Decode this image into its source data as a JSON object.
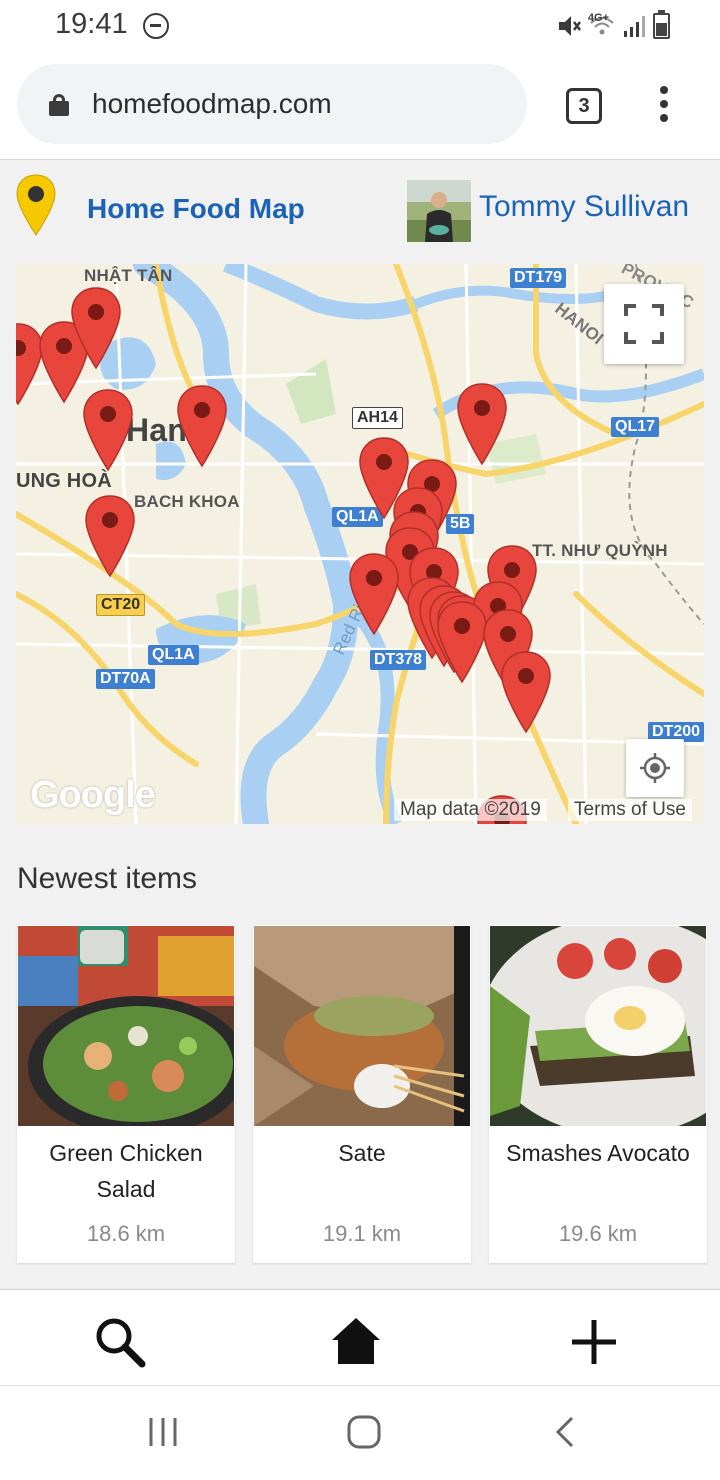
{
  "status_bar": {
    "time": "19:41",
    "network": "4G+",
    "icons": [
      "do-not-disturb-icon",
      "mute-icon",
      "wifi-icon",
      "signal-icon",
      "battery-icon"
    ]
  },
  "browser": {
    "url": "homefoodmap.com",
    "tab_count": "3",
    "icons": [
      "lock-icon",
      "more-vert-icon"
    ]
  },
  "header": {
    "brand": "Home Food Map",
    "user_name": "Tommy Sullivan",
    "brand_color": "#1a63b8",
    "logo_color": "#f6c800"
  },
  "map": {
    "labels": {
      "nhat_tan": "NHẬT TÂN",
      "hanoi": "Hanoi",
      "trung_hoa": "UNG HOÀ",
      "bach_khoa": "BACH KHOA",
      "nhu_quynh": "TT. NHƯ QUỲNH",
      "hanoi_road": "HANOI",
      "red_river": "Red River",
      "prov": "PROVINC"
    },
    "road_shields": {
      "dt179": "DT179",
      "ah14": "AH14",
      "ql17": "QL17",
      "ql1a_center": "QL1A",
      "ql1a_bottom": "QL1A",
      "ct20": "CT20",
      "dt70a": "DT70A",
      "dt378": "DT378",
      "dt200": "DT200",
      "c5b": "5B"
    },
    "attribution": "Map data ©2019",
    "terms": "Terms of Use",
    "google_logo": "Google",
    "pin_color": "#e8453c",
    "water_color": "#a9d0f2",
    "highway_color": "#f7d56b"
  },
  "newest": {
    "title": "Newest items",
    "items": [
      {
        "name": "Green Chicken Salad",
        "distance": "18.6 km"
      },
      {
        "name": "Sate",
        "distance": "19.1 km"
      },
      {
        "name": "Smashes Avocato",
        "distance": "19.6 km"
      }
    ]
  },
  "bottom_nav": {
    "icons": [
      "search-icon",
      "home-icon",
      "add-icon"
    ]
  },
  "system_nav": {
    "icons": [
      "recent-apps-icon",
      "home-circle-icon",
      "back-icon"
    ]
  }
}
